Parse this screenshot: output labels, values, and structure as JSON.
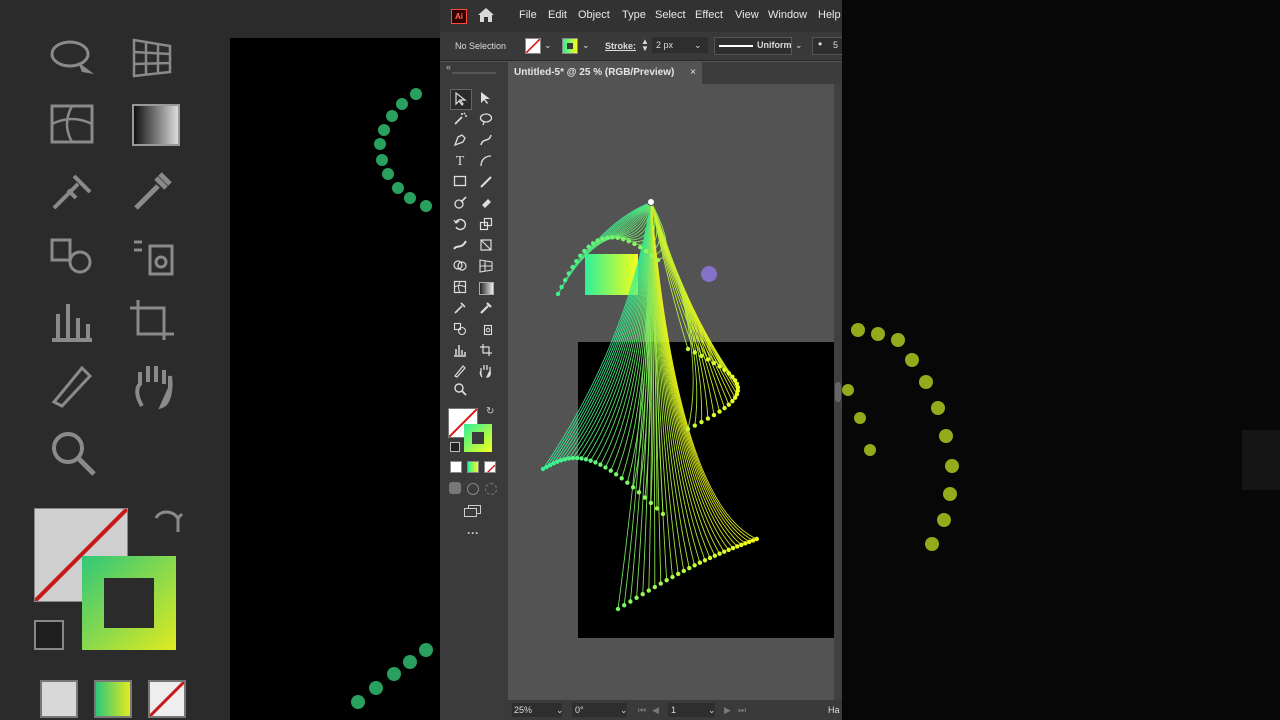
{
  "app": {
    "logo_text": "Ai",
    "menu": [
      "File",
      "Edit",
      "Object",
      "Type",
      "Select",
      "Effect",
      "View",
      "Window",
      "Help"
    ]
  },
  "control_bar": {
    "selection_label": "No Selection",
    "stroke_label": "Stroke:",
    "stroke_value": "2 px",
    "profile_label": "Uniform",
    "brush_size": "5"
  },
  "document_tab": {
    "title": "Untitled-5* @ 25 % (RGB/Preview)",
    "close_glyph": "×"
  },
  "status_bar": {
    "zoom": "25%",
    "rotation": "0°",
    "artboard_number": "1",
    "right_label": "Ha"
  },
  "toolbar": {
    "more_glyph": "···"
  },
  "colors": {
    "gradient_start": "#2ef09a",
    "gradient_end": "#f5ff1a",
    "handle_dot": "#8471c8",
    "panel_dark": "#3b3b3b",
    "canvas": "#535353"
  }
}
